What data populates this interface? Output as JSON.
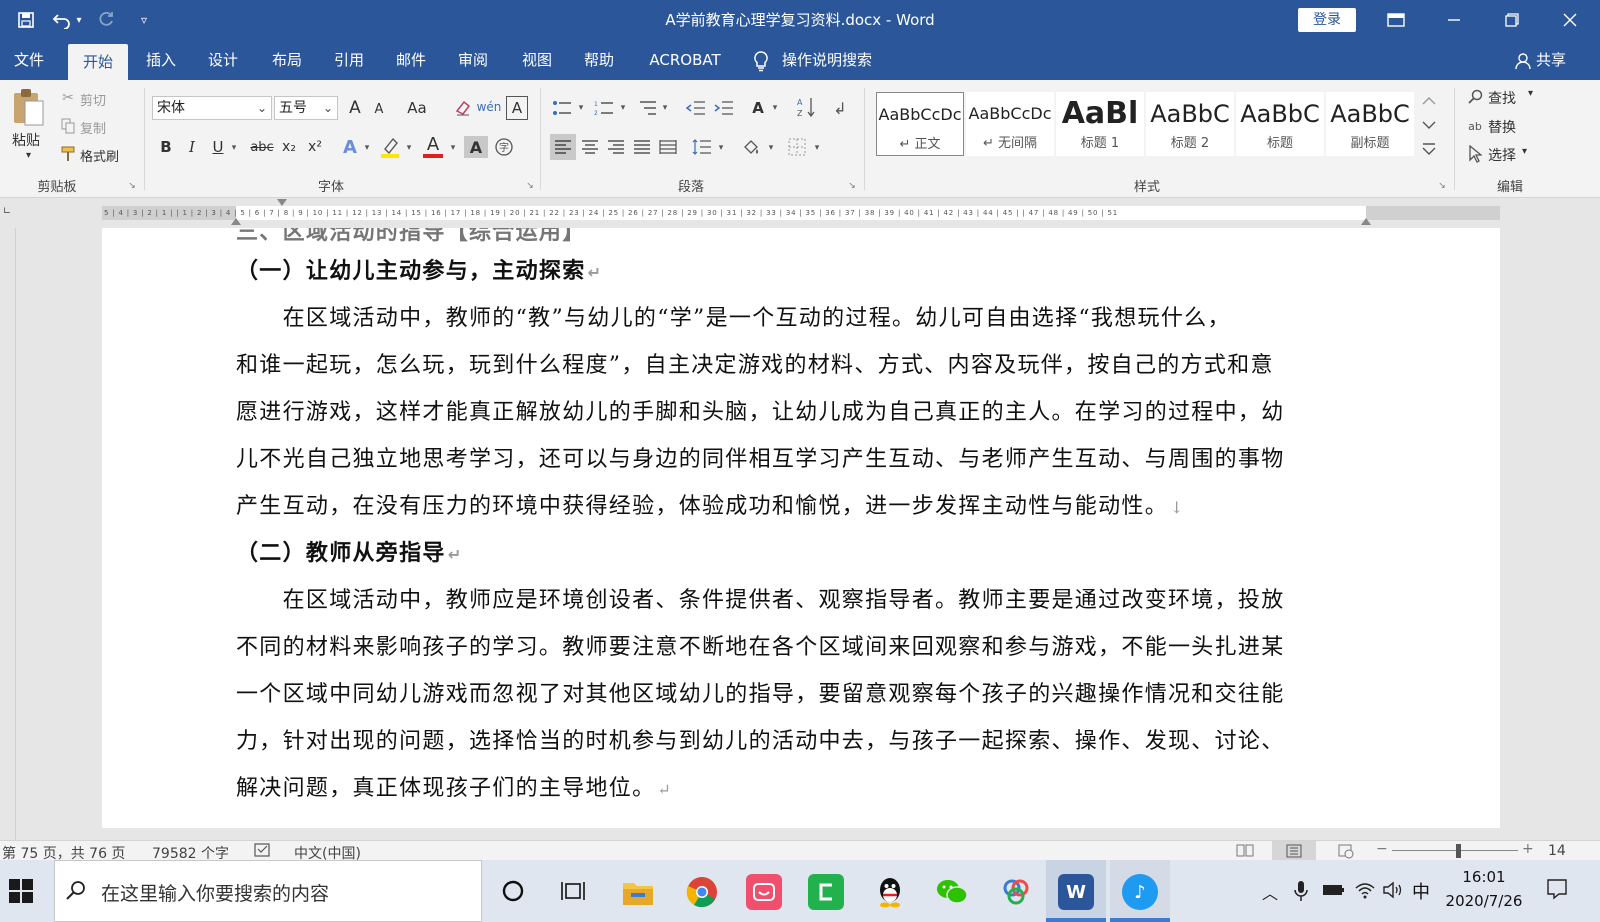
{
  "titlebar": {
    "document_title": "A学前教育心理学复习资料.docx  -  Word",
    "login_button": "登录",
    "qat_undo_dropdown": "▾",
    "qat_customize": "▿"
  },
  "tabs": [
    {
      "label": "文件"
    },
    {
      "label": "开始"
    },
    {
      "label": "插入"
    },
    {
      "label": "设计"
    },
    {
      "label": "布局"
    },
    {
      "label": "引用"
    },
    {
      "label": "邮件"
    },
    {
      "label": "审阅"
    },
    {
      "label": "视图"
    },
    {
      "label": "帮助"
    },
    {
      "label": "ACROBAT"
    }
  ],
  "tell_me": "操作说明搜索",
  "share": "共享",
  "ribbon": {
    "clipboard": {
      "paste": "粘贴",
      "cut": "剪切",
      "copy": "复制",
      "format_painter": "格式刷",
      "group_label": "剪贴板"
    },
    "font": {
      "font_name": "宋体",
      "font_size": "五号",
      "group_label": "字体",
      "grow": "A",
      "shrink": "A",
      "change_case": "Aa",
      "bold": "B",
      "italic": "I",
      "underline": "U",
      "strike": "abc",
      "subscript": "x₂",
      "superscript": "x²",
      "font_color": "A",
      "char_shading": "A"
    },
    "paragraph": {
      "group_label": "段落"
    },
    "styles": {
      "group_label": "样式",
      "items": [
        {
          "sample": "AaBbCcDc",
          "name": "↵ 正文"
        },
        {
          "sample": "AaBbCcDc",
          "name": "↵ 无间隔"
        },
        {
          "sample": "AaBl",
          "name": "标题 1"
        },
        {
          "sample": "AaBbC",
          "name": "标题 2"
        },
        {
          "sample": "AaBbC",
          "name": "标题"
        },
        {
          "sample": "AaBbC",
          "name": "副标题"
        }
      ]
    },
    "editing": {
      "group_label": "编辑",
      "find": "查找",
      "replace": "替换",
      "select": "选择"
    }
  },
  "ruler_ticks": "5 | 4 | 3 | 2 | 1 |   | 1 | 2 | 3 | 4 | 5 | 6 | 7 | 8 | 9 | 10 | 11 | 12 | 13 | 14 | 15 | 16 | 17 | 18 | 19 | 20 | 21 | 22 | 23 | 24 | 25 | 26 | 27 | 28 | 29 | 30 | 31 | 32 | 33 | 34 | 35 | 36 | 37 | 38 | 39 | 40 | 41 | 42 | 43 | 44 | 45 |   | 47 | 48 | 49 | 50 | 51",
  "document": {
    "cut_heading": "三、区域活动的指导【综合运用】",
    "lines": [
      {
        "text": "（一）让幼儿主动参与，主动探索",
        "mark": "↵",
        "heading": true
      },
      {
        "text": "　　在区域活动中，教师的“教”与幼儿的“学”是一个互动的过程。幼儿可自由选择“我想玩什么，",
        "mark": ""
      },
      {
        "text": "和谁一起玩，怎么玩，玩到什么程度”，自主决定游戏的材料、方式、内容及玩伴，按自己的方式和意",
        "mark": ""
      },
      {
        "text": "愿进行游戏，这样才能真正解放幼儿的手脚和头脑，让幼儿成为自己真正的主人。在学习的过程中，幼",
        "mark": ""
      },
      {
        "text": "儿不光自己独立地思考学习，还可以与身边的同伴相互学习产生互动、与老师产生互动、与周围的事物",
        "mark": ""
      },
      {
        "text": "产生互动，在没有压力的环境中获得经验，体验成功和愉悦，进一步发挥主动性与能动性。",
        "mark": "↓"
      },
      {
        "text": "（二）教师从旁指导",
        "mark": "↵",
        "heading": true
      },
      {
        "text": "　　在区域活动中，教师应是环境创设者、条件提供者、观察指导者。教师主要是通过改变环境，投放",
        "mark": ""
      },
      {
        "text": "不同的材料来影响孩子的学习。教师要注意不断地在各个区域间来回观察和参与游戏，不能一头扎进某",
        "mark": ""
      },
      {
        "text": "一个区域中同幼儿游戏而忽视了对其他区域幼儿的指导，要留意观察每个孩子的兴趣操作情况和交往能",
        "mark": ""
      },
      {
        "text": "力，针对出现的问题，选择恰当的时机参与到幼儿的活动中去，与孩子一起探索、操作、发现、讨论、",
        "mark": ""
      },
      {
        "text": "解决问题，真正体现孩子们的主导地位。",
        "mark": "↵"
      }
    ]
  },
  "status": {
    "page": "第 75 页，共 76 页",
    "words": "79582 个字",
    "language": "中文(中国)",
    "zoom": "14"
  },
  "taskbar": {
    "search_placeholder": "在这里输入你要搜索的内容",
    "ime": "中",
    "time": "16:01",
    "date": "2020/7/26"
  },
  "colors": {
    "word_blue": "#2b579a",
    "ribbon_bg": "#f3f3f3",
    "font_red": "#e02020",
    "highlight_yellow": "#ffe600"
  }
}
